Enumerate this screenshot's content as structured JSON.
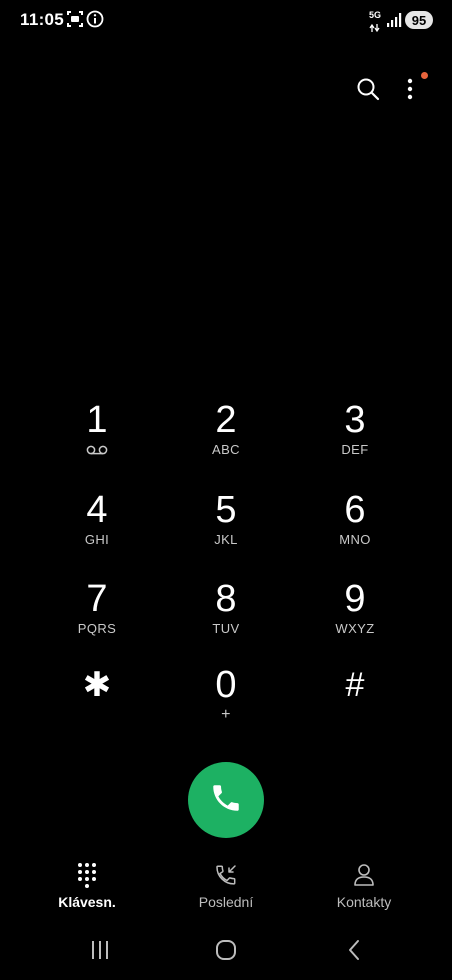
{
  "status_bar": {
    "time": "11:05",
    "network_label": "5G",
    "battery": "95"
  },
  "top_actions": {
    "search_icon": "search-icon",
    "more_icon": "more-vertical-icon",
    "notification_dot_color": "#e8643c"
  },
  "keypad": {
    "keys": [
      {
        "digit": "1",
        "letters": "",
        "sub_icon": "voicemail-icon"
      },
      {
        "digit": "2",
        "letters": "ABC"
      },
      {
        "digit": "3",
        "letters": "DEF"
      },
      {
        "digit": "4",
        "letters": "GHI"
      },
      {
        "digit": "5",
        "letters": "JKL"
      },
      {
        "digit": "6",
        "letters": "MNO"
      },
      {
        "digit": "7",
        "letters": "PQRS"
      },
      {
        "digit": "8",
        "letters": "TUV"
      },
      {
        "digit": "9",
        "letters": "WXYZ"
      },
      {
        "digit": "✱",
        "letters": ""
      },
      {
        "digit": "0",
        "letters": "+"
      },
      {
        "digit": "#",
        "letters": ""
      }
    ]
  },
  "call_button": {
    "icon": "phone-icon",
    "color": "#1db163"
  },
  "tabs": [
    {
      "label": "Klávesn.",
      "icon": "keypad-icon",
      "active": true
    },
    {
      "label": "Poslední",
      "icon": "recent-calls-icon",
      "active": false
    },
    {
      "label": "Kontakty",
      "icon": "contacts-icon",
      "active": false
    }
  ],
  "nav_bar": {
    "recents_icon": "recents-icon",
    "home_icon": "home-icon",
    "back_icon": "back-icon"
  }
}
